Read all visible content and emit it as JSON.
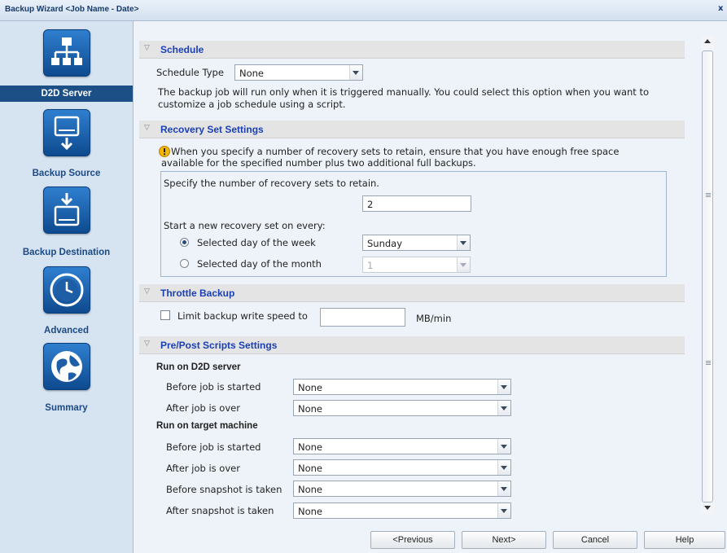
{
  "window": {
    "title": "Backup Wizard <Job Name - Date>",
    "close_glyph": "x"
  },
  "sidebar": {
    "items": [
      {
        "label": "D2D Server",
        "icon": "network-server-icon",
        "active": true
      },
      {
        "label": "Backup Source",
        "icon": "drive-upload-icon",
        "active": false
      },
      {
        "label": "Backup Destination",
        "icon": "drive-download-icon",
        "active": false
      },
      {
        "label": "Advanced",
        "icon": "clock-icon",
        "active": false
      },
      {
        "label": "Summary",
        "icon": "globe-icon",
        "active": false
      }
    ]
  },
  "schedule": {
    "title": "Schedule",
    "type_label": "Schedule Type",
    "type_value": "None",
    "description_line1": "The backup job will run only when it is triggered manually. You could select this option when you want to",
    "description_line2": "customize a job schedule using a script."
  },
  "recovery": {
    "title": "Recovery Set Settings",
    "warning_line1": "When you specify a number of recovery sets to retain, ensure that you have enough free space",
    "warning_line2": "available for the specified number plus two additional full backups.",
    "retain_label": "Specify the number of recovery sets to retain.",
    "retain_value": "2",
    "start_label": "Start a new recovery set on every:",
    "week_label": "Selected day of the week",
    "week_value": "Sunday",
    "month_label": "Selected day of the month",
    "month_value": "1"
  },
  "throttle": {
    "title": "Throttle Backup",
    "limit_label": "Limit backup write speed to",
    "limit_value": "",
    "unit": "MB/min"
  },
  "scripts": {
    "title": "Pre/Post Scripts Settings",
    "d2d_heading": "Run on D2D server",
    "d2d_before_label": "Before job is started",
    "d2d_before_value": "None",
    "d2d_after_label": "After job is over",
    "d2d_after_value": "None",
    "target_heading": "Run on target machine",
    "t_before_label": "Before job is started",
    "t_before_value": "None",
    "t_after_label": "After job is over",
    "t_after_value": "None",
    "t_snap_before_label": "Before snapshot is taken",
    "t_snap_before_value": "None",
    "t_snap_after_label": "After snapshot is taken",
    "t_snap_after_value": "None"
  },
  "footer": {
    "previous": "<Previous",
    "next": "Next>",
    "cancel": "Cancel",
    "help": "Help"
  }
}
